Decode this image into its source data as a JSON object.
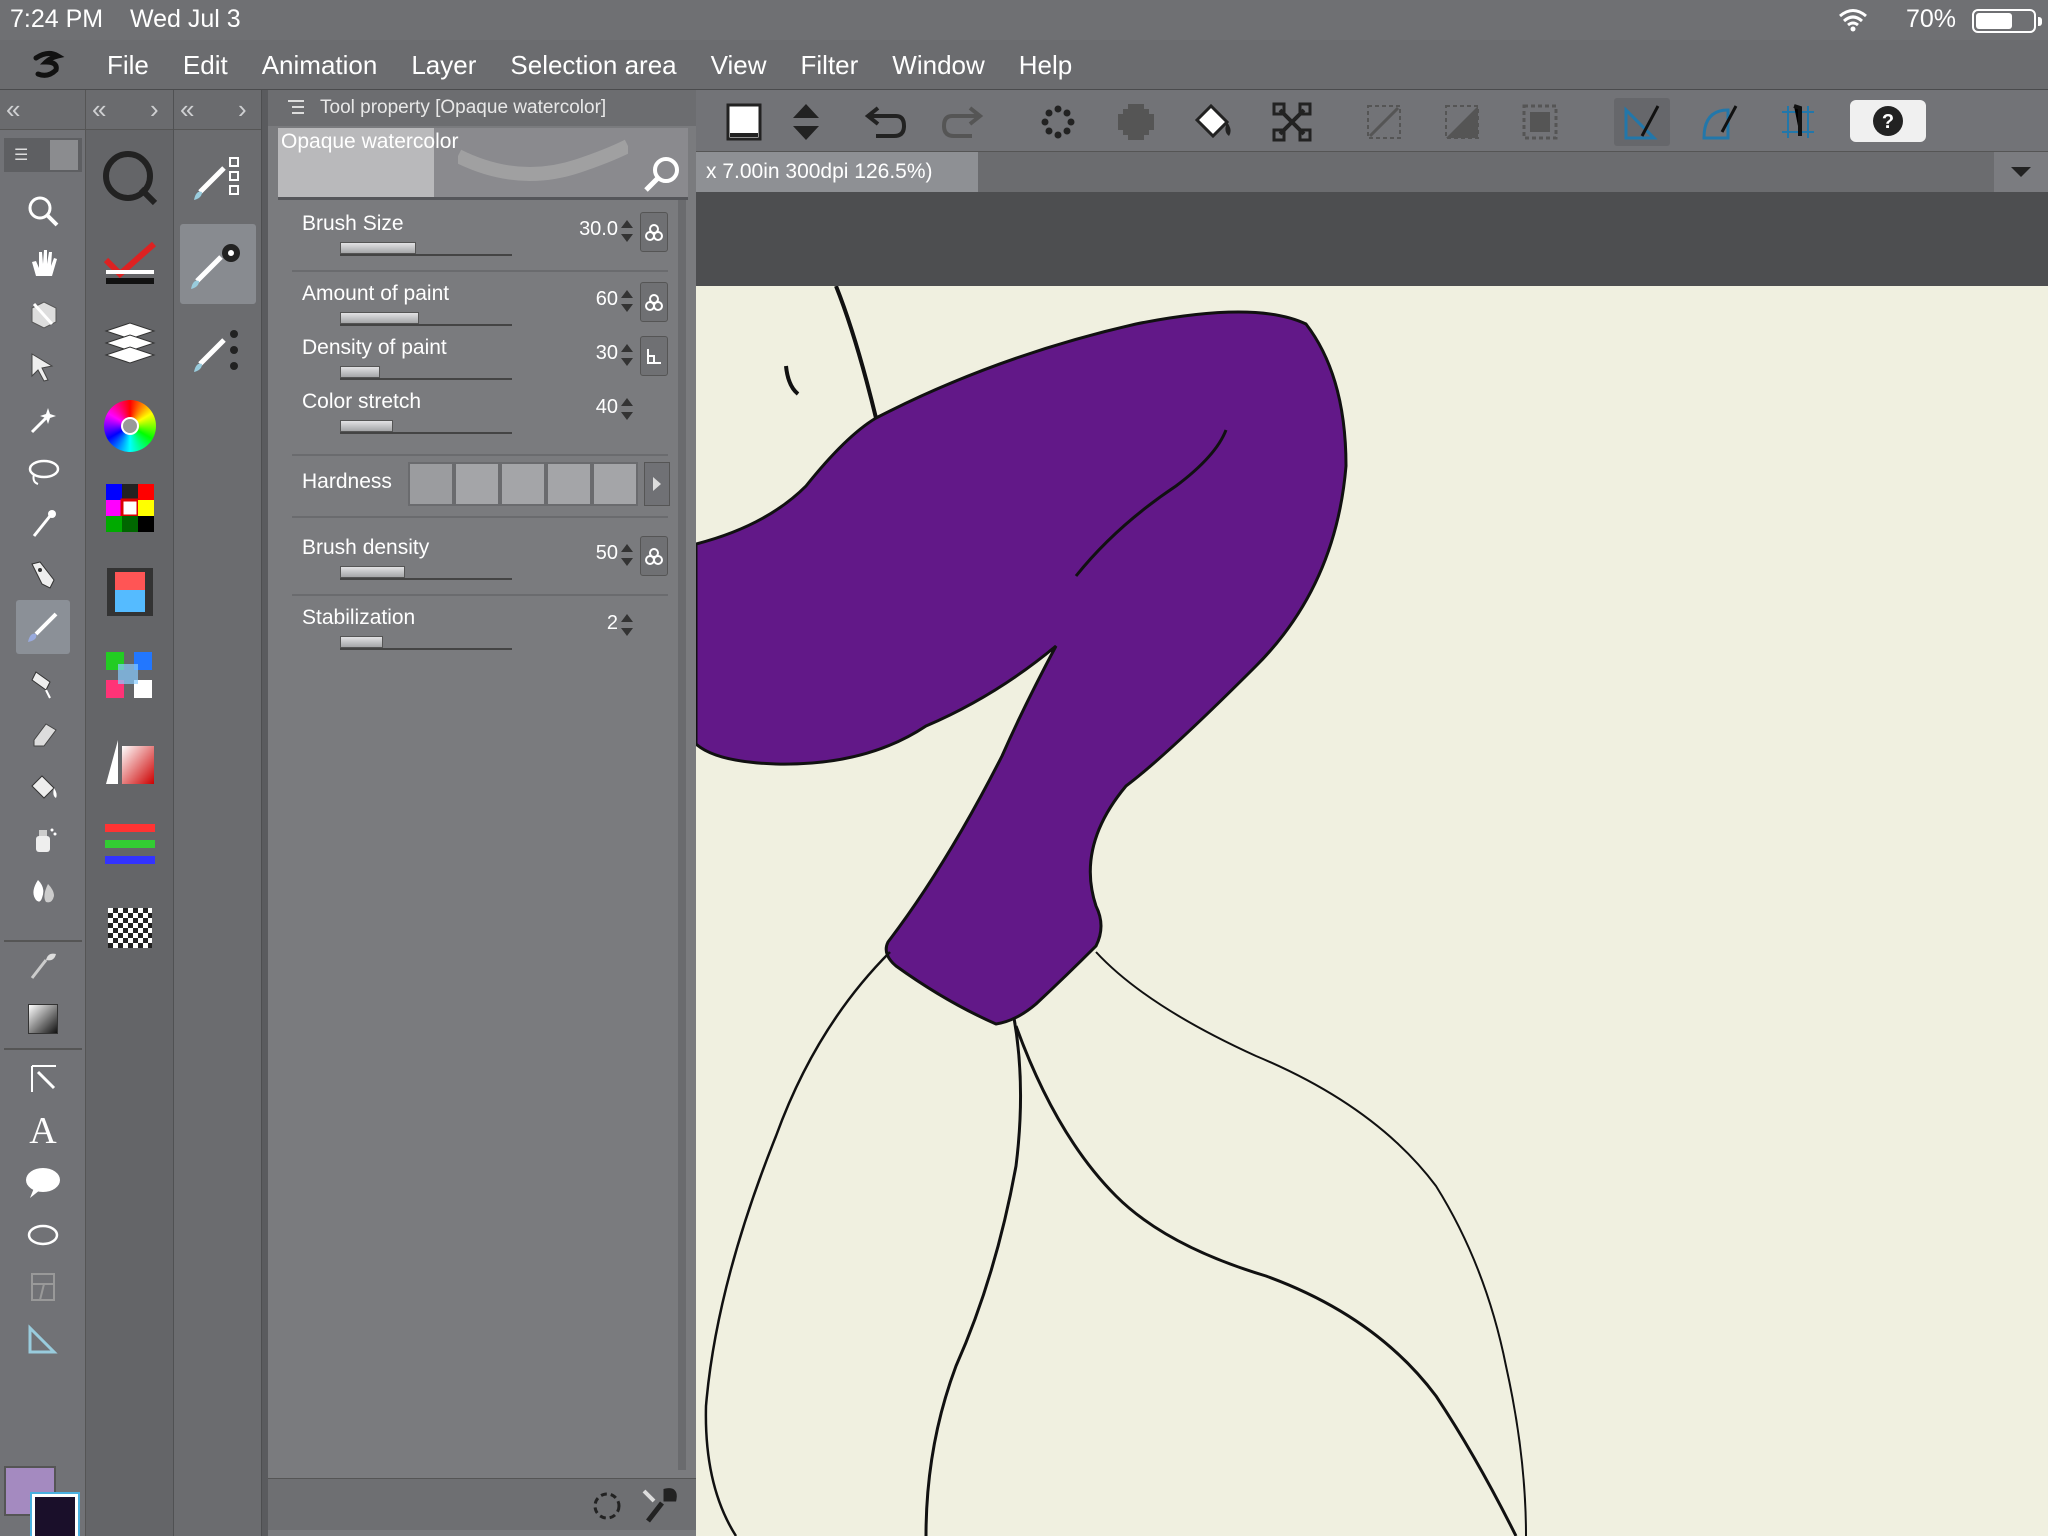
{
  "status_bar": {
    "time": "7:24 PM",
    "date": "Wed Jul 3",
    "battery": "70%"
  },
  "menu": [
    "File",
    "Edit",
    "Animation",
    "Layer",
    "Selection area",
    "View",
    "Filter",
    "Window",
    "Help"
  ],
  "panel": {
    "title": "Tool property [Opaque watercolor]",
    "brush_name": "Opaque watercolor",
    "properties": [
      {
        "label": "Brush Size",
        "value": "30.0",
        "fill": 0.44
      },
      {
        "label": "Amount of paint",
        "value": "60",
        "fill": 0.46
      },
      {
        "label": "Density of paint",
        "value": "30",
        "fill": 0.23
      },
      {
        "label": "Color stretch",
        "value": "40",
        "fill": 0.31
      },
      {
        "label": "Hardness"
      },
      {
        "label": "Brush density",
        "value": "50",
        "fill": 0.38
      },
      {
        "label": "Stabilization",
        "value": "2",
        "fill": 0.25
      }
    ]
  },
  "canvas_tab": {
    "label": "x 7.00in 300dpi 126.5%)"
  },
  "colors": {
    "main": "#a48ac0",
    "sub": "#1a0f2a",
    "sweater": "#621888",
    "paper": "#f0f0e0"
  },
  "icons": {
    "tools": [
      "zoom-icon",
      "hand-icon",
      "object-icon",
      "move-icon",
      "magic-wand-icon",
      "lasso-icon",
      "eyedropper-icon",
      "pen-icon",
      "brush-icon",
      "airbrush-icon",
      "eraser-icon",
      "fill-icon",
      "spray-icon",
      "blend-icon",
      "decoration-icon",
      "gradient-icon",
      "operation-icon",
      "text-icon",
      "balloon-icon",
      "ellipse-icon",
      "frame-icon",
      "ruler-icon"
    ],
    "palettes": [
      "navigator-icon",
      "check-icon",
      "layers-icon",
      "color-wheel-icon",
      "color-set-icon",
      "timeline-icon",
      "sub-view-icon",
      "gradient-map-icon",
      "color-slider-icon",
      "material-icon"
    ]
  }
}
